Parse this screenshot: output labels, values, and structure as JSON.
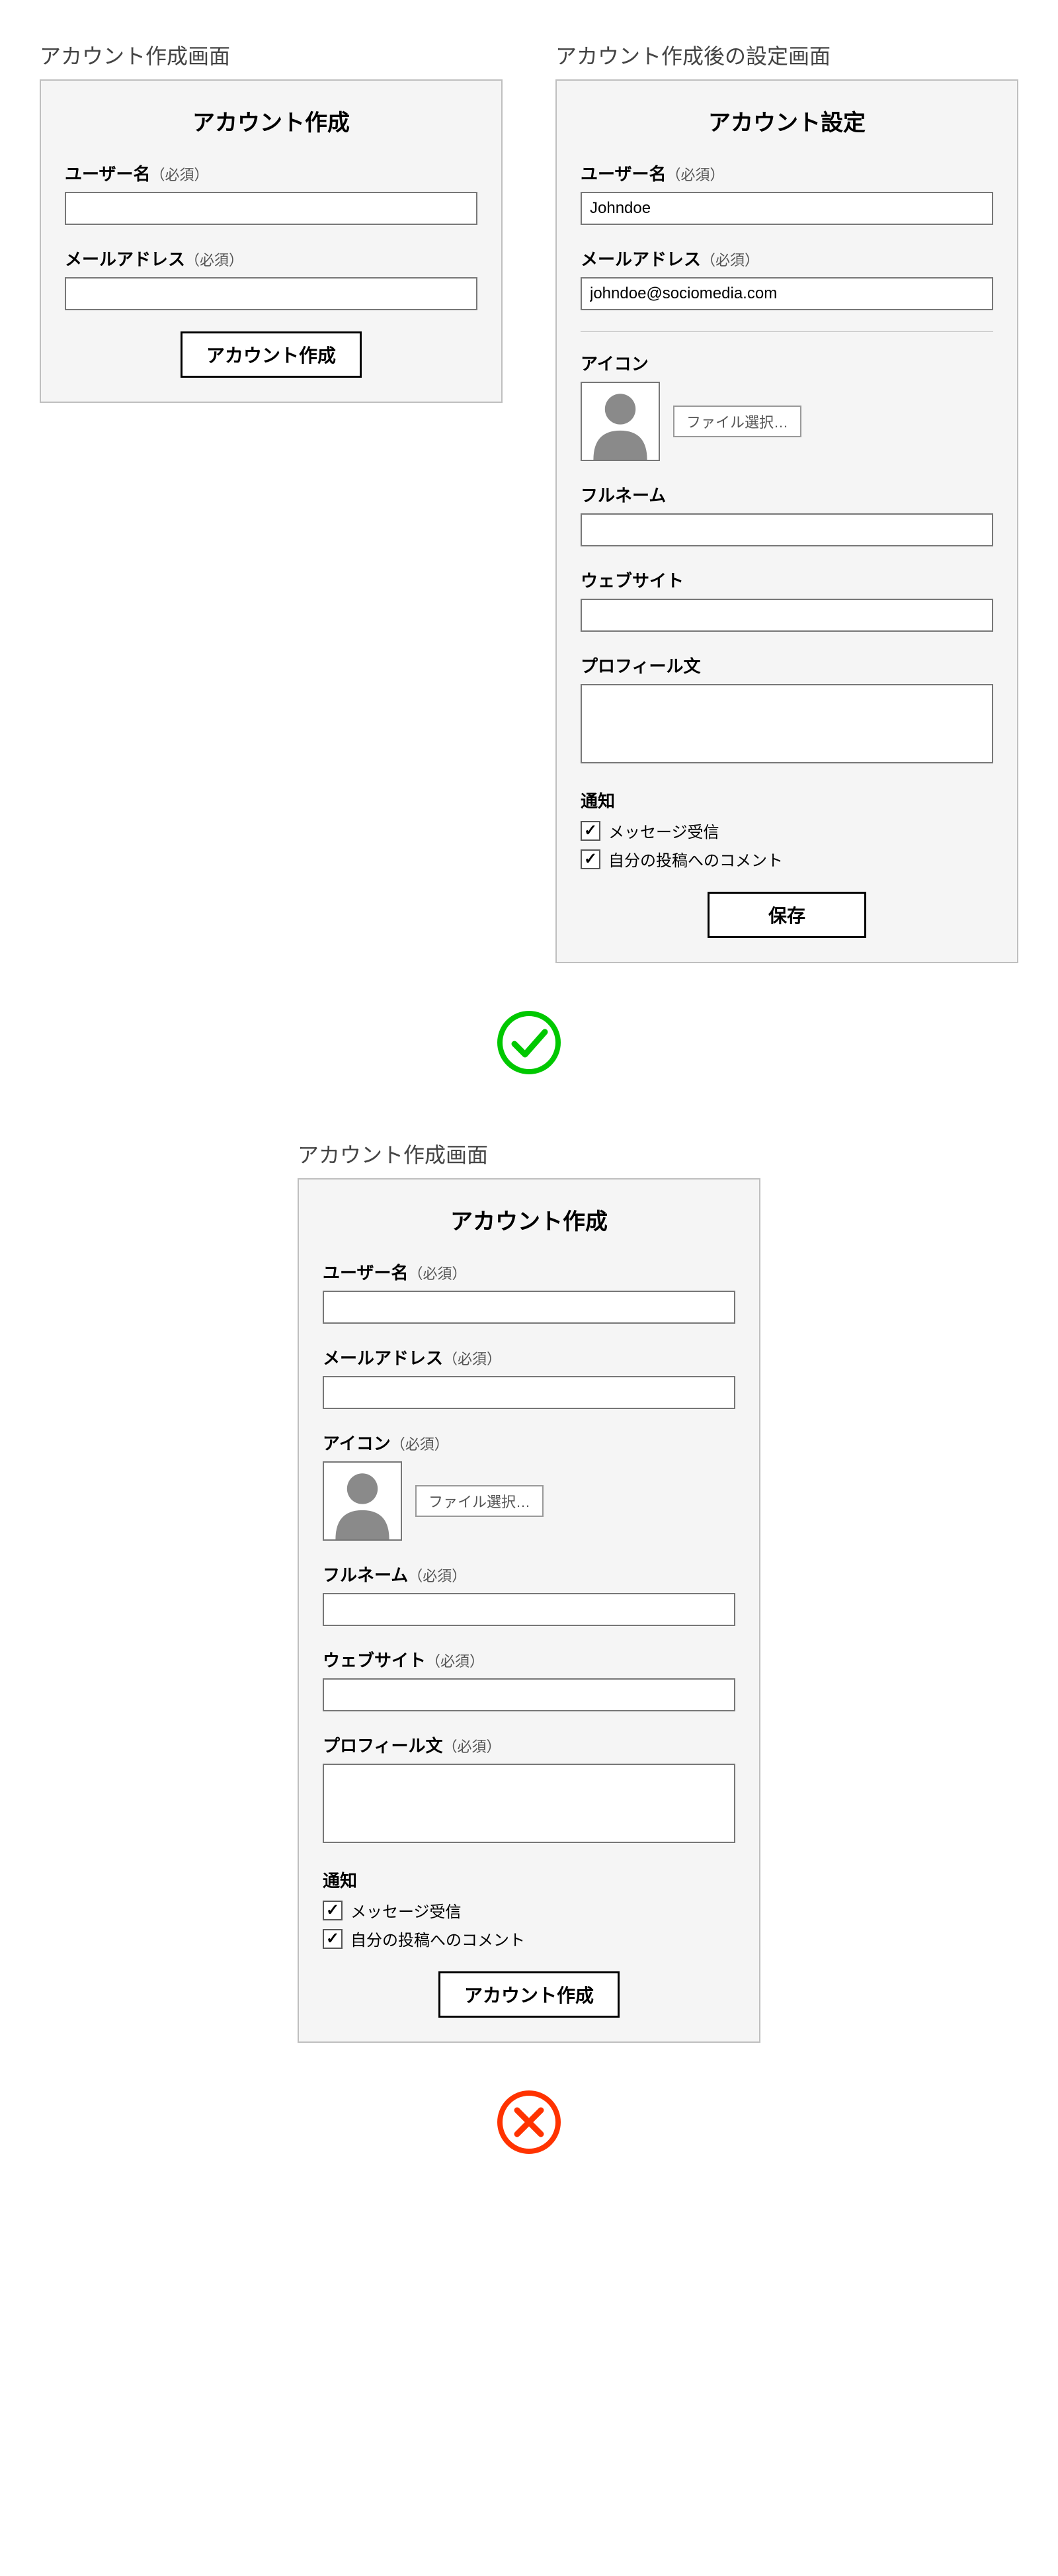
{
  "good": {
    "create": {
      "screen_title": "アカウント作成画面",
      "panel_title": "アカウント作成",
      "username_label": "ユーザー名",
      "username_req": "（必須）",
      "email_label": "メールアドレス",
      "email_req": "（必須）",
      "submit_label": "アカウント作成"
    },
    "settings": {
      "screen_title": "アカウント作成後の設定画面",
      "panel_title": "アカウント設定",
      "username_label": "ユーザー名",
      "username_req": "（必須）",
      "username_value": "Johndoe",
      "email_label": "メールアドレス",
      "email_req": "（必須）",
      "email_value": "johndoe@sociomedia.com",
      "icon_label": "アイコン",
      "file_label": "ファイル選択…",
      "fullname_label": "フルネーム",
      "website_label": "ウェブサイト",
      "profile_label": "プロフィール文",
      "notify_label": "通知",
      "cb1_label": "メッセージ受信",
      "cb2_label": "自分の投稿へのコメント",
      "submit_label": "保存"
    }
  },
  "bad": {
    "create": {
      "screen_title": "アカウント作成画面",
      "panel_title": "アカウント作成",
      "username_label": "ユーザー名",
      "username_req": "（必須）",
      "email_label": "メールアドレス",
      "email_req": "（必須）",
      "icon_label": "アイコン",
      "icon_req": "（必須）",
      "file_label": "ファイル選択…",
      "fullname_label": "フルネーム",
      "fullname_req": "（必須）",
      "website_label": "ウェブサイト",
      "website_req": "（必須）",
      "profile_label": "プロフィール文",
      "profile_req": "（必須）",
      "notify_label": "通知",
      "cb1_label": "メッセージ受信",
      "cb2_label": "自分の投稿へのコメント",
      "submit_label": "アカウント作成"
    }
  },
  "icons": {
    "check": "✓"
  }
}
